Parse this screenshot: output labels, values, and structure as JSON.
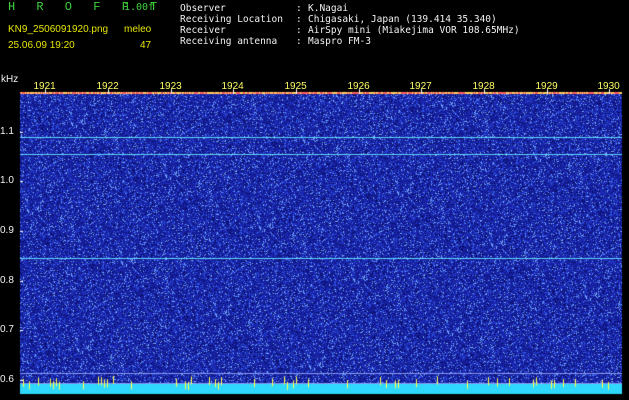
{
  "header": {
    "title": "H R O F F T",
    "version": "1.00f",
    "filename": "KN9_2506091920.png",
    "app_label": "meleo",
    "datetime": "25.06.09 19:20",
    "count": "47"
  },
  "meta": [
    {
      "label": "Observer",
      "value": "K.Nagai"
    },
    {
      "label": "Receiving Location",
      "value": "Chigasaki, Japan (139.414 35.340)"
    },
    {
      "label": "Receiver",
      "value": "AirSpy mini (Miakejima VOR 108.65MHz)"
    },
    {
      "label": "Receiving antenna",
      "value": "Maspro FM-3"
    }
  ],
  "colors": {
    "background": "#000000",
    "waterfall_base": "#141c96",
    "header_green": "#3cd23c",
    "header_yellow": "#e6e600",
    "trace_cyan": "#66e8ff"
  },
  "chart_data": {
    "type": "heatmap",
    "ylabel": "kHz",
    "y_ticks": [
      "1.1",
      "1.0",
      "0.9",
      "0.8",
      "0.7",
      "0.6"
    ],
    "x_ticks": [
      "1921",
      "1922",
      "1923",
      "1924",
      "1925",
      "1926",
      "1927",
      "1928",
      "1929",
      "1930"
    ],
    "ylim": [
      0.58,
      1.18
    ],
    "xlim": [
      1920.6,
      1930.2
    ],
    "tick_y_values": [
      1.1,
      1.0,
      0.9,
      0.8,
      0.7,
      0.6
    ],
    "tick_x_values": [
      1921,
      1922,
      1923,
      1924,
      1925,
      1926,
      1927,
      1928,
      1929,
      1930
    ],
    "horizontal_traces_khz": [
      1.09,
      1.055,
      0.845,
      0.615,
      0.595
    ]
  }
}
